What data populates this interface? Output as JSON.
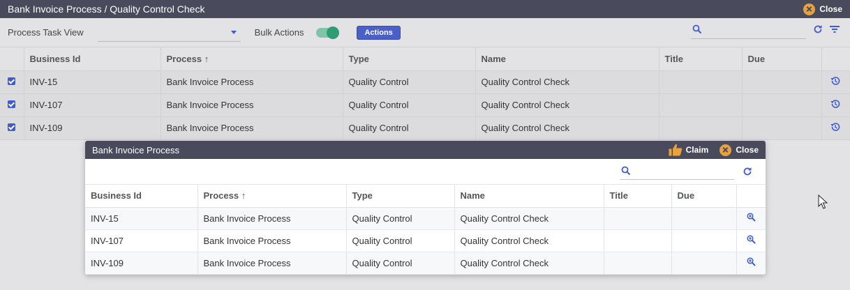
{
  "window": {
    "title": "Bank Invoice Process / Quality Control Check",
    "close_label": "Close"
  },
  "toolbar": {
    "view_label": "Process Task View",
    "view_select_value": "",
    "bulk_label": "Bulk Actions",
    "bulk_enabled": true,
    "actions_label": "Actions",
    "search_placeholder": ""
  },
  "main_table": {
    "columns": [
      "Business Id",
      "Process",
      "Type",
      "Name",
      "Title",
      "Due"
    ],
    "sort_indicator": "↑",
    "rows": [
      {
        "business_id": "INV-15",
        "process": "Bank Invoice Process",
        "type": "Quality Control",
        "name": "Quality Control Check",
        "title": "",
        "due": ""
      },
      {
        "business_id": "INV-107",
        "process": "Bank Invoice Process",
        "type": "Quality Control",
        "name": "Quality Control Check",
        "title": "",
        "due": ""
      },
      {
        "business_id": "INV-109",
        "process": "Bank Invoice Process",
        "type": "Quality Control",
        "name": "Quality Control Check",
        "title": "",
        "due": ""
      }
    ]
  },
  "popup": {
    "title": "Bank Invoice Process",
    "claim_label": "Claim",
    "close_label": "Close",
    "search_placeholder": "",
    "columns": [
      "Business Id",
      "Process",
      "Type",
      "Name",
      "Title",
      "Due"
    ],
    "sort_indicator": "↑",
    "rows": [
      {
        "business_id": "INV-15",
        "process": "Bank Invoice Process",
        "type": "Quality Control",
        "name": "Quality Control Check",
        "title": "",
        "due": ""
      },
      {
        "business_id": "INV-107",
        "process": "Bank Invoice Process",
        "type": "Quality Control",
        "name": "Quality Control Check",
        "title": "",
        "due": ""
      },
      {
        "business_id": "INV-109",
        "process": "Bank Invoice Process",
        "type": "Quality Control",
        "name": "Quality Control Check",
        "title": "",
        "due": ""
      }
    ]
  },
  "colors": {
    "titlebar": "#494b5c",
    "accent": "#3d5ccf",
    "close_icon": "#e9a13b",
    "toggle_on": "#2e9d74"
  },
  "icons": {
    "close": "close-circle-icon",
    "claim": "thumbs-up-icon",
    "search": "search-icon",
    "refresh": "refresh-icon",
    "filter": "filter-icon",
    "history": "history-icon",
    "zoom": "zoom-in-icon"
  }
}
